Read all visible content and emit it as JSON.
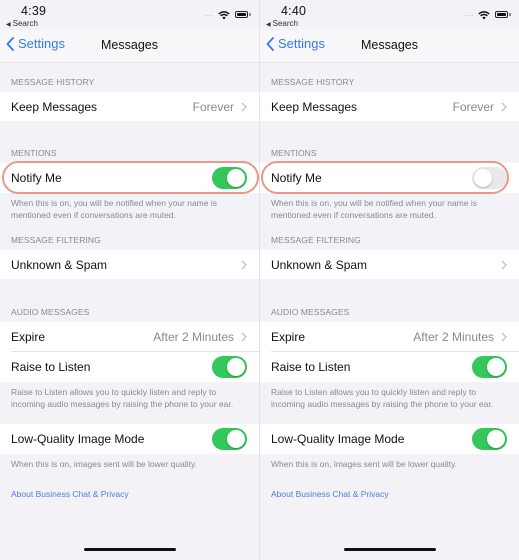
{
  "panels": [
    {
      "status": {
        "time": "4:39",
        "back_app": "Search",
        "icons": [
          "signal-dots-icon",
          "wifi-icon",
          "battery-icon"
        ]
      },
      "nav": {
        "back_label": "Settings",
        "title": "Messages"
      },
      "sections": {
        "message_history": {
          "header": "MESSAGE HISTORY",
          "keep_messages": {
            "label": "Keep Messages",
            "value": "Forever"
          }
        },
        "mentions": {
          "header": "MENTIONS",
          "notify_me": {
            "label": "Notify Me",
            "on": true
          },
          "footer": "When this is on, you will be notified when your name is mentioned even if conversations are muted."
        },
        "message_filtering": {
          "header": "MESSAGE FILTERING",
          "unknown_spam": {
            "label": "Unknown & Spam"
          }
        },
        "audio_messages": {
          "header": "AUDIO MESSAGES",
          "expire": {
            "label": "Expire",
            "value": "After 2 Minutes"
          },
          "raise_to_listen": {
            "label": "Raise to Listen",
            "on": true
          },
          "footer": "Raise to Listen allows you to quickly listen and reply to incoming audio messages by raising the phone to your ear."
        },
        "low_quality": {
          "label": "Low-Quality Image Mode",
          "on": true,
          "footer": "When this is on, images sent will be lower quality."
        },
        "about_link": "About Business Chat & Privacy"
      }
    },
    {
      "status": {
        "time": "4:40",
        "back_app": "Search",
        "icons": [
          "signal-dots-icon",
          "wifi-icon",
          "battery-icon"
        ]
      },
      "nav": {
        "back_label": "Settings",
        "title": "Messages"
      },
      "sections": {
        "message_history": {
          "header": "MESSAGE HISTORY",
          "keep_messages": {
            "label": "Keep Messages",
            "value": "Forever"
          }
        },
        "mentions": {
          "header": "MENTIONS",
          "notify_me": {
            "label": "Notify Me",
            "on": false
          },
          "footer": "When this is on, you will be notified when your name is mentioned even if conversations are muted."
        },
        "message_filtering": {
          "header": "MESSAGE FILTERING",
          "unknown_spam": {
            "label": "Unknown & Spam"
          }
        },
        "audio_messages": {
          "header": "AUDIO MESSAGES",
          "expire": {
            "label": "Expire",
            "value": "After 2 Minutes"
          },
          "raise_to_listen": {
            "label": "Raise to Listen",
            "on": true
          },
          "footer": "Raise to Listen allows you to quickly listen and reply to incoming audio messages by raising the phone to your ear."
        },
        "low_quality": {
          "label": "Low-Quality Image Mode",
          "on": true,
          "footer": "When this is on, images sent will be lower quality."
        },
        "about_link": "About Business Chat & Privacy"
      }
    }
  ],
  "colors": {
    "accent": "#3478f6",
    "toggle_on": "#34c759",
    "toggle_off": "#e9e9eb",
    "highlight": "#e8998a",
    "background": "#f2f2f7",
    "link": "#4d7fd6"
  }
}
